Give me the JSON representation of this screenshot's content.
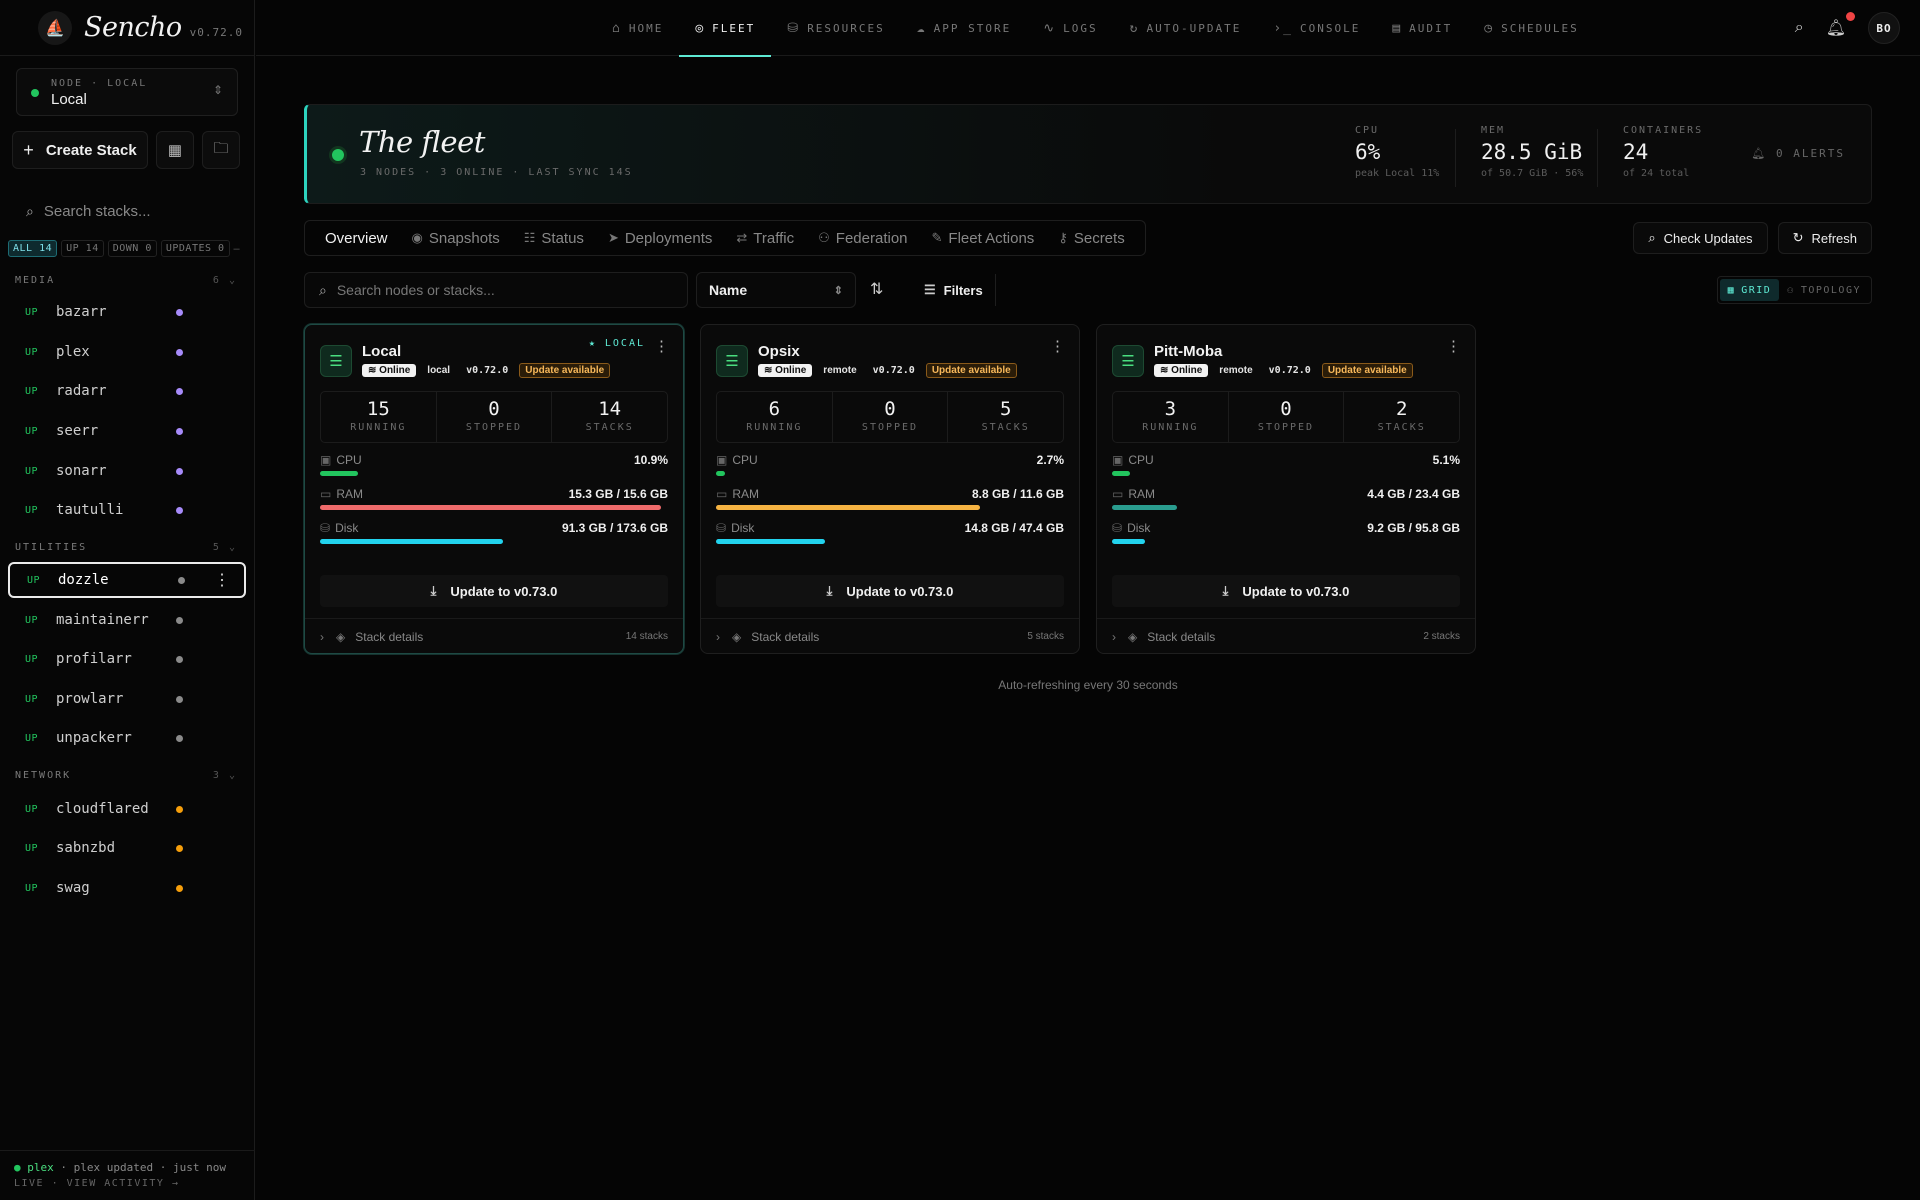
{
  "brand": {
    "name": "Sencho",
    "version": "v0.72.0"
  },
  "node_switch": {
    "label": "NODE · LOCAL",
    "value": "Local"
  },
  "sidebar": {
    "create_label": "Create Stack",
    "search_placeholder": "Search stacks...",
    "filters": [
      "ALL 14",
      "UP 14",
      "DOWN 0",
      "UPDATES 0"
    ],
    "groups": [
      {
        "name": "MEDIA",
        "count": "6",
        "color": "#a78bfa",
        "items": [
          {
            "status": "UP",
            "name": "bazarr"
          },
          {
            "status": "UP",
            "name": "plex"
          },
          {
            "status": "UP",
            "name": "radarr"
          },
          {
            "status": "UP",
            "name": "seerr"
          },
          {
            "status": "UP",
            "name": "sonarr"
          },
          {
            "status": "UP",
            "name": "tautulli"
          }
        ]
      },
      {
        "name": "UTILITIES",
        "count": "5",
        "color": "#8a8a8a",
        "items": [
          {
            "status": "UP",
            "name": "dozzle"
          },
          {
            "status": "UP",
            "name": "maintainerr"
          },
          {
            "status": "UP",
            "name": "profilarr"
          },
          {
            "status": "UP",
            "name": "prowlarr"
          },
          {
            "status": "UP",
            "name": "unpackerr"
          }
        ]
      },
      {
        "name": "NETWORK",
        "count": "3",
        "color": "#f59e0b",
        "items": [
          {
            "status": "UP",
            "name": "cloudflared"
          },
          {
            "status": "UP",
            "name": "sabnzbd"
          },
          {
            "status": "UP",
            "name": "swag"
          }
        ]
      }
    ],
    "activity": {
      "name": "plex",
      "text": "· plex updated · just now",
      "live": "LIVE · VIEW ACTIVITY →"
    }
  },
  "nav": {
    "tabs": [
      {
        "label": "HOME",
        "icon": "home-icon"
      },
      {
        "label": "FLEET",
        "icon": "fleet-icon"
      },
      {
        "label": "RESOURCES",
        "icon": "resources-icon"
      },
      {
        "label": "APP STORE",
        "icon": "app-store-icon"
      },
      {
        "label": "LOGS",
        "icon": "logs-icon"
      },
      {
        "label": "AUTO-UPDATE",
        "icon": "auto-update-icon"
      },
      {
        "label": "CONSOLE",
        "icon": "console-icon"
      },
      {
        "label": "AUDIT",
        "icon": "audit-icon"
      },
      {
        "label": "SCHEDULES",
        "icon": "schedules-icon"
      }
    ],
    "active": "FLEET",
    "avatar": "BO"
  },
  "fleet": {
    "title": "The fleet",
    "subtitle": "3 NODES · 3 ONLINE · LAST SYNC 14S",
    "cpu": {
      "label": "CPU",
      "value": "6%",
      "sub": "peak Local 11%"
    },
    "mem": {
      "label": "MEM",
      "value": "28.5 GiB",
      "sub": "of 50.7 GiB · 56%"
    },
    "containers": {
      "label": "CONTAINERS",
      "value": "24",
      "sub": "of 24 total"
    },
    "alerts": "0 ALERTS"
  },
  "subtabs": [
    "Overview",
    "Snapshots",
    "Status",
    "Deployments",
    "Traffic",
    "Federation",
    "Fleet Actions",
    "Secrets"
  ],
  "actions": {
    "check_updates": "Check Updates",
    "refresh": "Refresh"
  },
  "toolbar": {
    "search_placeholder": "Search nodes or stacks...",
    "sort": "Name",
    "filters": "Filters",
    "view_grid": "GRID",
    "view_topology": "TOPOLOGY"
  },
  "nodes": [
    {
      "name": "Local",
      "status": "Online",
      "type": "local",
      "version": "v0.72.0",
      "update_badge": "Update available",
      "local_tag": "★ LOCAL",
      "running": "15",
      "stopped": "0",
      "stacks": "14",
      "cpu": "10.9%",
      "cpu_pct": 0.109,
      "ram": "15.3 GB / 15.6 GB",
      "ram_pct": 0.98,
      "disk": "91.3 GB / 173.6 GB",
      "disk_pct": 0.526,
      "ram_color": "#ef6b6b",
      "update_btn": "Update to v0.73.0",
      "details": "Stack details",
      "details_count": "14 stacks"
    },
    {
      "name": "Opsix",
      "status": "Online",
      "type": "remote",
      "version": "v0.72.0",
      "update_badge": "Update available",
      "local_tag": "",
      "running": "6",
      "stopped": "0",
      "stacks": "5",
      "cpu": "2.7%",
      "cpu_pct": 0.027,
      "ram": "8.8 GB / 11.6 GB",
      "ram_pct": 0.759,
      "disk": "14.8 GB / 47.4 GB",
      "disk_pct": 0.312,
      "ram_color": "#f5b342",
      "update_btn": "Update to v0.73.0",
      "details": "Stack details",
      "details_count": "5 stacks"
    },
    {
      "name": "Pitt-Moba",
      "status": "Online",
      "type": "remote",
      "version": "v0.72.0",
      "update_badge": "Update available",
      "local_tag": "",
      "running": "3",
      "stopped": "0",
      "stacks": "2",
      "cpu": "5.1%",
      "cpu_pct": 0.051,
      "ram": "4.4 GB / 23.4 GB",
      "ram_pct": 0.188,
      "disk": "9.2 GB / 95.8 GB",
      "disk_pct": 0.096,
      "ram_color": "#2a9d8f",
      "update_btn": "Update to v0.73.0",
      "details": "Stack details",
      "details_count": "2 stacks"
    }
  ],
  "stat_labels": {
    "running": "RUNNING",
    "stopped": "STOPPED",
    "stacks": "STACKS"
  },
  "res_labels": {
    "cpu": "CPU",
    "ram": "RAM",
    "disk": "Disk"
  },
  "footer": "Auto-refreshing every 30 seconds"
}
